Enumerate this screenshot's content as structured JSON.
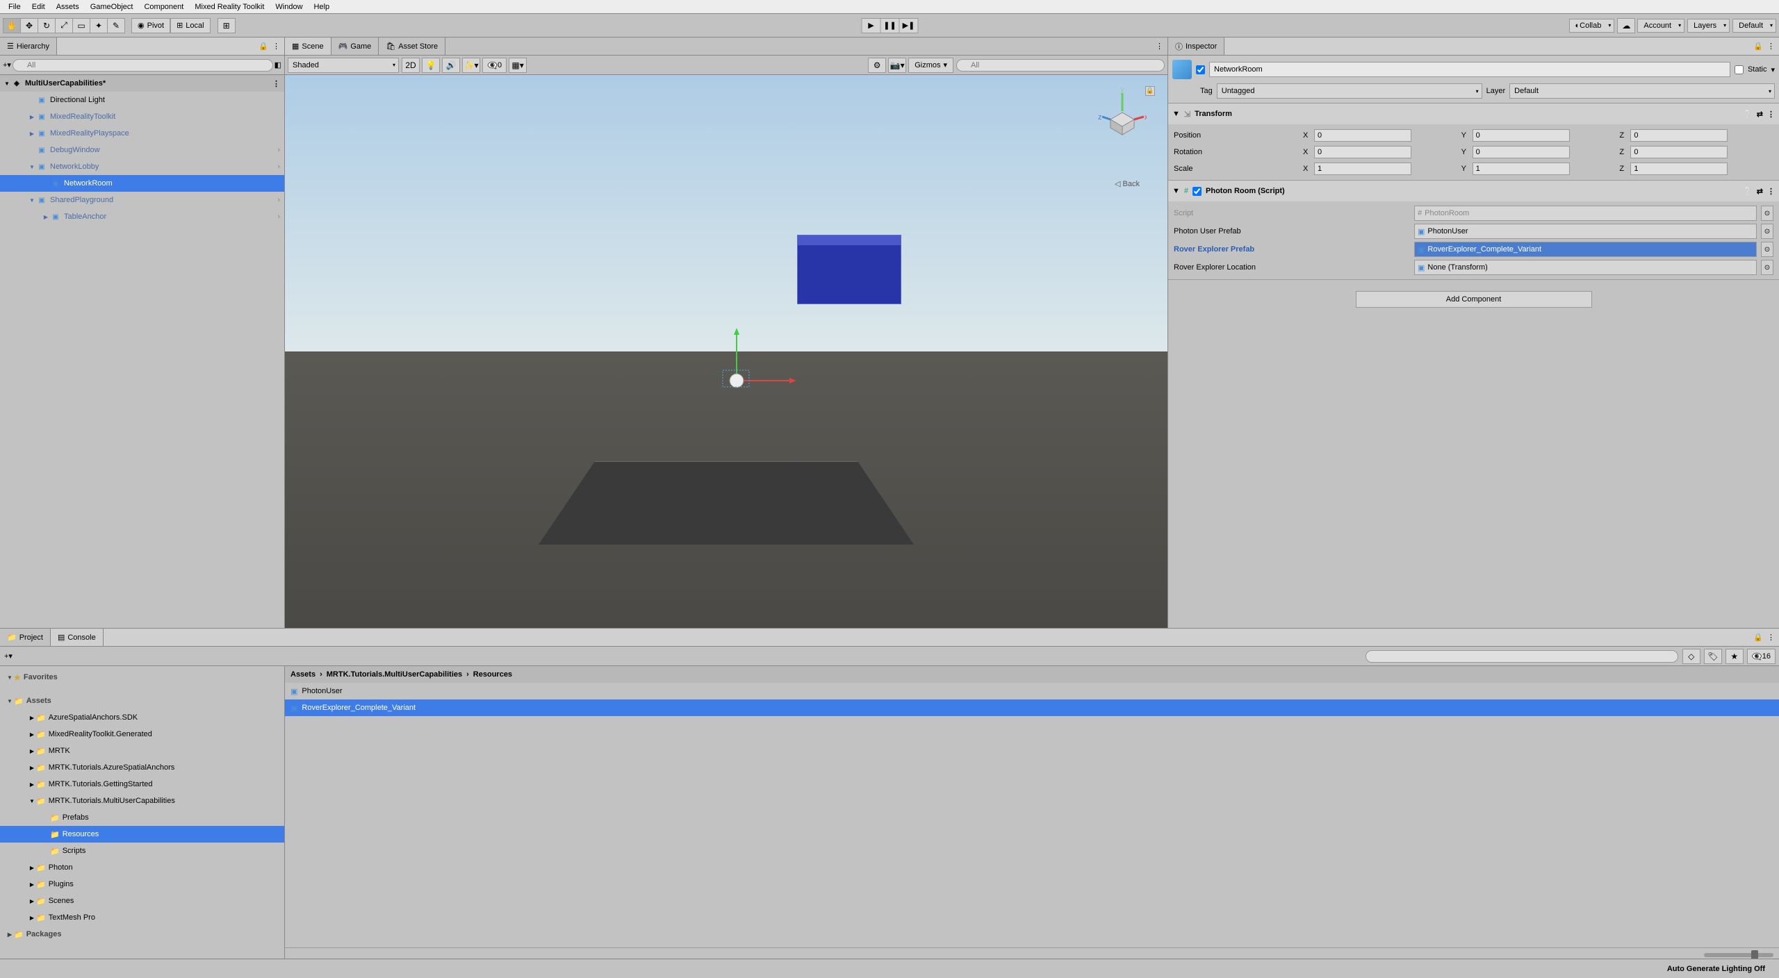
{
  "menubar": [
    "File",
    "Edit",
    "Assets",
    "GameObject",
    "Component",
    "Mixed Reality Toolkit",
    "Window",
    "Help"
  ],
  "toolbar": {
    "pivot": "Pivot",
    "local": "Local",
    "collab": "Collab",
    "account": "Account",
    "layers": "Layers",
    "layout": "Default"
  },
  "hierarchy": {
    "title": "Hierarchy",
    "searchPlaceholder": "All",
    "scene": "MultiUserCapabilities*",
    "items": [
      {
        "label": "Directional Light",
        "indent": 1,
        "prefab": false
      },
      {
        "label": "MixedRealityToolkit",
        "indent": 1,
        "prefab": true,
        "arrow": true
      },
      {
        "label": "MixedRealityPlayspace",
        "indent": 1,
        "prefab": true,
        "arrow": true
      },
      {
        "label": "DebugWindow",
        "indent": 1,
        "prefab": true,
        "exp": true
      },
      {
        "label": "NetworkLobby",
        "indent": 1,
        "prefab": true,
        "open": true,
        "exp": true
      },
      {
        "label": "NetworkRoom",
        "indent": 2,
        "prefab": false,
        "selected": true
      },
      {
        "label": "SharedPlayground",
        "indent": 1,
        "prefab": true,
        "open": true,
        "exp": true
      },
      {
        "label": "TableAnchor",
        "indent": 2,
        "prefab": true,
        "arrow": true,
        "exp": true
      }
    ]
  },
  "sceneTabs": {
    "scene": "Scene",
    "game": "Game",
    "asset": "Asset Store"
  },
  "sceneToolbar": {
    "shaded": "Shaded",
    "twoD": "2D",
    "gizmos": "Gizmos",
    "zero": "0",
    "allPlaceholder": "All",
    "back": "Back"
  },
  "inspector": {
    "title": "Inspector",
    "name": "NetworkRoom",
    "static": "Static",
    "tagLabel": "Tag",
    "tag": "Untagged",
    "layerLabel": "Layer",
    "layer": "Default",
    "transform": {
      "title": "Transform",
      "rows": [
        {
          "label": "Position",
          "x": "0",
          "y": "0",
          "z": "0"
        },
        {
          "label": "Rotation",
          "x": "0",
          "y": "0",
          "z": "0"
        },
        {
          "label": "Scale",
          "x": "1",
          "y": "1",
          "z": "1"
        }
      ]
    },
    "photon": {
      "title": "Photon Room (Script)",
      "scriptLabel": "Script",
      "script": "PhotonRoom",
      "props": [
        {
          "label": "Photon User Prefab",
          "value": "PhotonUser",
          "highlighted": false
        },
        {
          "label": "Rover Explorer Prefab",
          "value": "RoverExplorer_Complete_Variant",
          "highlighted": true,
          "labelHighlight": true
        },
        {
          "label": "Rover Explorer Location",
          "value": "None (Transform)",
          "highlighted": false
        }
      ]
    },
    "addComponent": "Add Component"
  },
  "project": {
    "title": "Project",
    "console": "Console",
    "favorites": "Favorites",
    "assets": "Assets",
    "packages": "Packages",
    "folders": [
      "AzureSpatialAnchors.SDK",
      "MixedRealityToolkit.Generated",
      "MRTK",
      "MRTK.Tutorials.AzureSpatialAnchors",
      "MRTK.Tutorials.GettingStarted",
      "MRTK.Tutorials.MultiUserCapabilities",
      "Prefabs",
      "Resources",
      "Scripts",
      "Photon",
      "Plugins",
      "Scenes",
      "TextMesh Pro"
    ],
    "breadcrumb": [
      "Assets",
      "MRTK.Tutorials.MultiUserCapabilities",
      "Resources"
    ],
    "assetsList": [
      {
        "label": "PhotonUser",
        "selected": false
      },
      {
        "label": "RoverExplorer_Complete_Variant",
        "selected": true
      }
    ],
    "count": "16"
  },
  "footer": "Auto Generate Lighting Off"
}
